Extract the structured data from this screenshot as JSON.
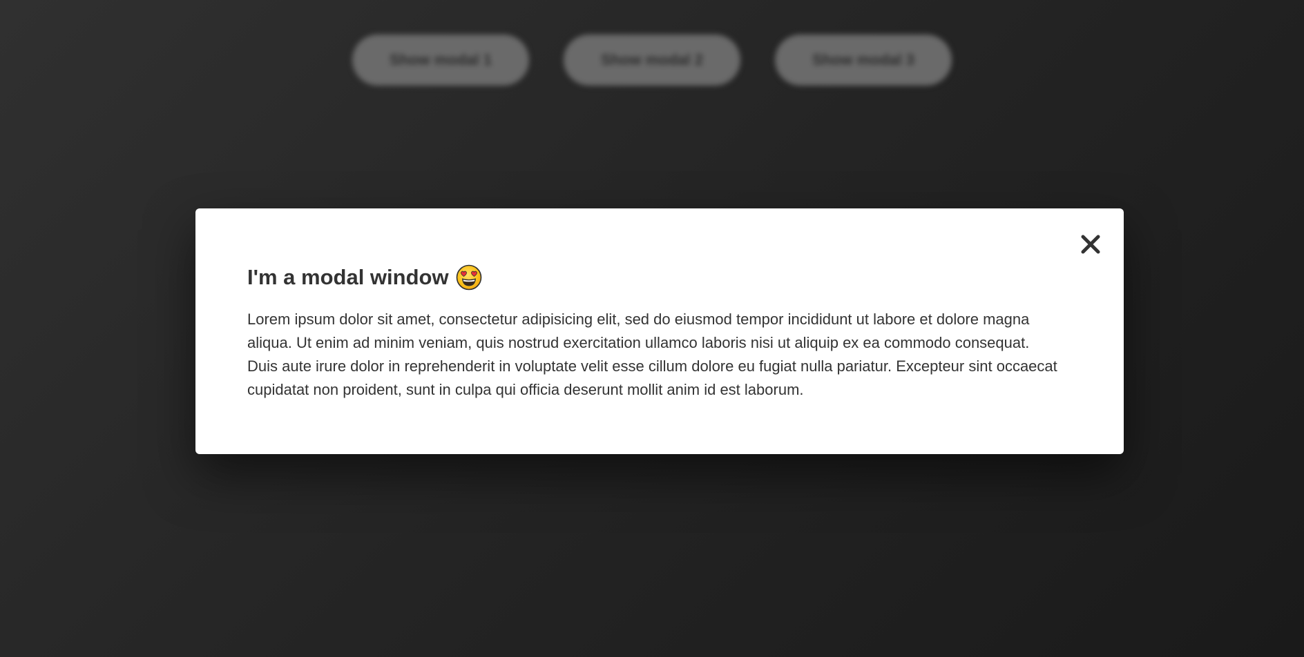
{
  "background": {
    "buttons": [
      {
        "label": "Show modal 1"
      },
      {
        "label": "Show modal 2"
      },
      {
        "label": "Show modal 3"
      }
    ]
  },
  "modal": {
    "title": "I'm a modal window",
    "title_icon": "heart-eyes-emoji-icon",
    "close_icon": "close-icon",
    "body": "Lorem ipsum dolor sit amet, consectetur adipisicing elit, sed do eiusmod tempor incididunt ut labore et dolore magna aliqua. Ut enim ad minim veniam, quis nostrud exercitation ullamco laboris nisi ut aliquip ex ea commodo consequat. Duis aute irure dolor in reprehenderit in voluptate velit esse cillum dolore eu fugiat nulla pariatur. Excepteur sint occaecat cupidatat non proident, sunt in culpa qui officia deserunt mollit anim id est laborum."
  },
  "colors": {
    "overlay": "#242424",
    "modal_bg": "#ffffff",
    "text": "#333333",
    "bg_button": "#6a6a6a"
  }
}
